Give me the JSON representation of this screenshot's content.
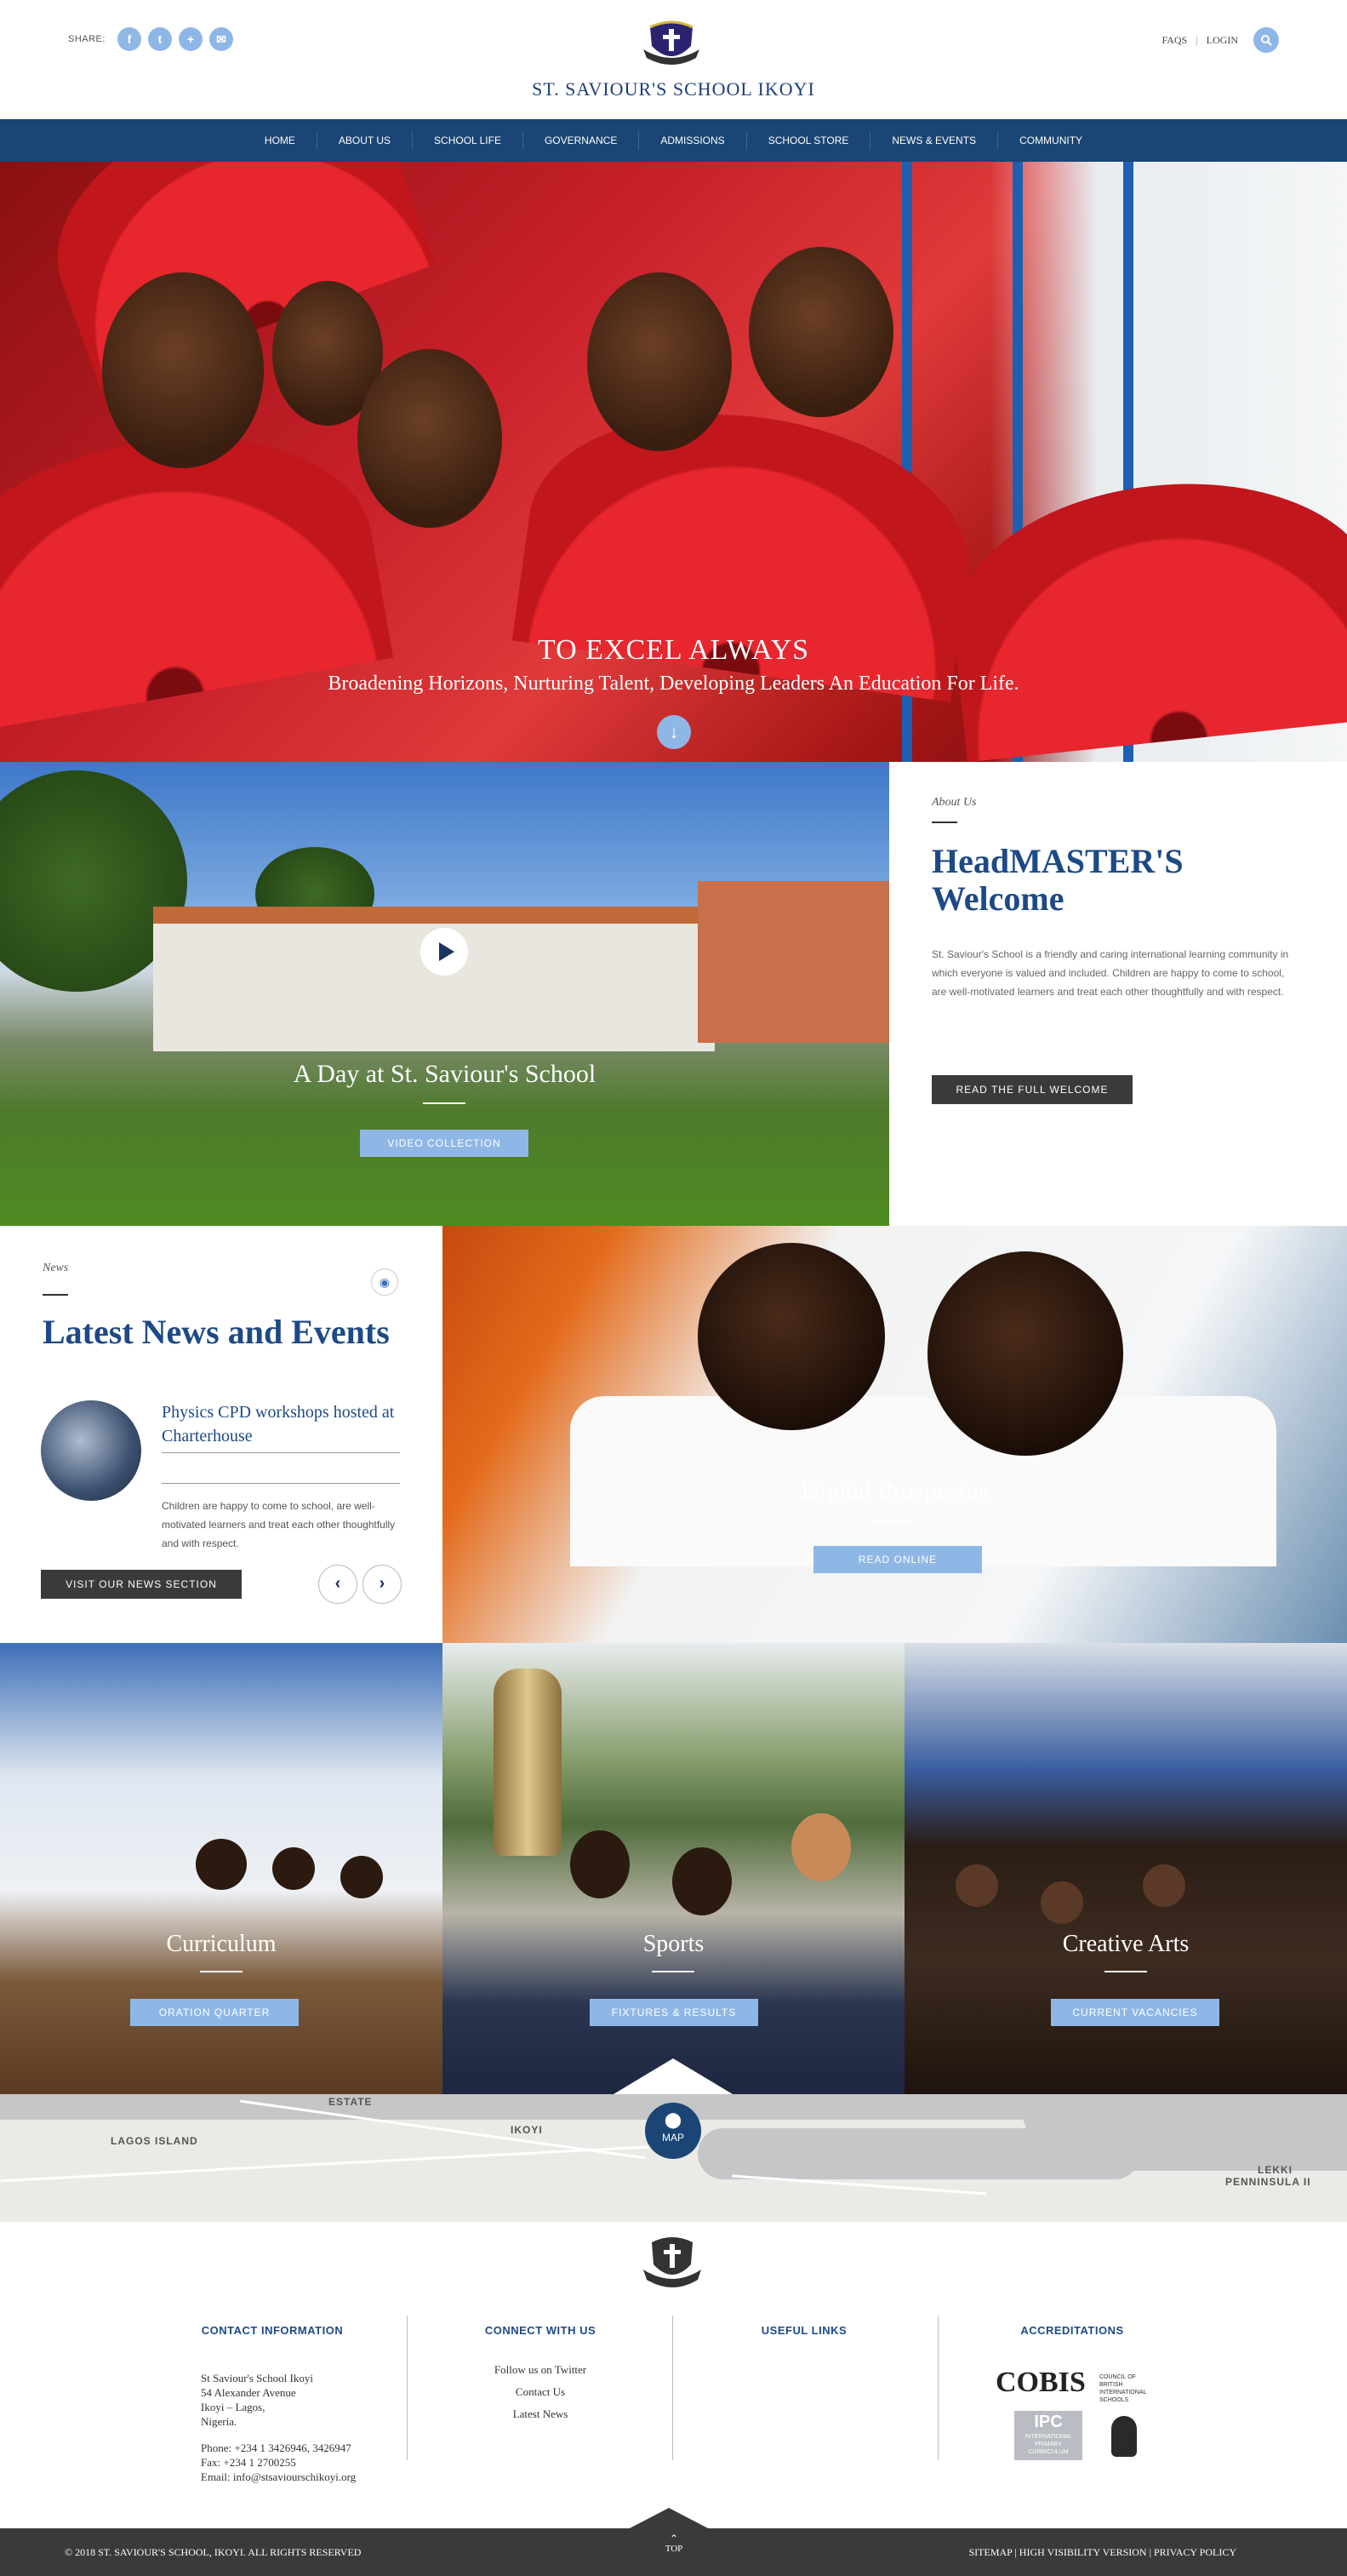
{
  "header": {
    "share_label": "SHARE:",
    "share_icons": [
      "facebook-icon",
      "twitter-icon",
      "plus-icon",
      "email-icon"
    ],
    "school_name": "ST. SAVIOUR'S SCHOOL IKOYI",
    "faqs": "FAQS",
    "separator": "|",
    "login": "LOGIN"
  },
  "nav": [
    "HOME",
    "ABOUT US",
    "SCHOOL LIFE",
    "GOVERNANCE",
    "ADMISSIONS",
    "SCHOOL STORE",
    "NEWS & EVENTS",
    "COMMUNITY"
  ],
  "hero": {
    "title": "TO EXCEL ALWAYS",
    "subtitle": "Broadening Horizons, Nurturing Talent, Developing Leaders An Education For Life."
  },
  "video": {
    "title": "A Day at St. Saviour's School",
    "button": "VIDEO COLLECTION"
  },
  "about": {
    "label": "About Us",
    "heading": "HeadMASTER'S Welcome",
    "text": "St. Saviour's School is a friendly and caring international learning community in which everyone is valued and included. Children are happy to come to school, are well-motivated learners and treat each other thoughtfully and with respect.",
    "button": "READ THE FULL WELCOME"
  },
  "news": {
    "label": "News",
    "heading": "Latest News and Events",
    "item_title": "Physics CPD workshops hosted at Charterhouse",
    "item_text": "Children are happy to come to school, are well-motivated learners and treat each other thoughtfully and with respect.",
    "button": "VISIT OUR NEWS SECTION",
    "prev": "‹",
    "next": "›"
  },
  "prospectus": {
    "title": "Digital Prospectus",
    "button": "READ ONLINE"
  },
  "tiles": [
    {
      "title": "Curriculum",
      "button": "ORATION QUARTER"
    },
    {
      "title": "Sports",
      "button": "FIXTURES & RESULTS"
    },
    {
      "title": "Creative Arts",
      "button": "CURRENT VACANCIES"
    }
  ],
  "map": {
    "button": "MAP",
    "labels": [
      "LAGOS ISLAND",
      "IKOYI",
      "LEKKI",
      "PENNINSULA II",
      "ESTATE"
    ]
  },
  "footer": {
    "contact_heading": "CONTACT INFORMATION",
    "address_lines": [
      "St Saviour's School Ikoyi",
      "54 Alexander Avenue",
      "Ikoyi – Lagos,",
      "Nigeria."
    ],
    "phone": "Phone: +234 1 3426946, 3426947",
    "fax": "Fax: +234 1 2700255",
    "email": "Email: info@stsaviourschikoyi.org",
    "connect_heading": "CONNECT WITH US",
    "connect_links": [
      "Follow us on Twitter",
      "Contact Us",
      "Latest News"
    ],
    "useful_heading": "USEFUL LINKS",
    "accred_heading": "ACCREDITATIONS",
    "cobis": "COBIS",
    "cobis_sub": "COUNCIL OF BRITISH INTERNATIONAL SCHOOLS",
    "ipc": "IPC",
    "ipc_sub": "INTERNATIONAL PRIMARY CURRICULUM"
  },
  "bottom": {
    "copyright": "© 2018 ST. SAVIOUR'S SCHOOL, IKOYI. ALL RIGHTS RESERVED",
    "top": "TOP",
    "links": "SITEMAP | HIGH VISIBILITY VERSION | PRIVACY POLICY"
  },
  "colors": {
    "navy": "#1a4574",
    "accent": "#8fb7e6",
    "dark": "#3a3a3a"
  }
}
